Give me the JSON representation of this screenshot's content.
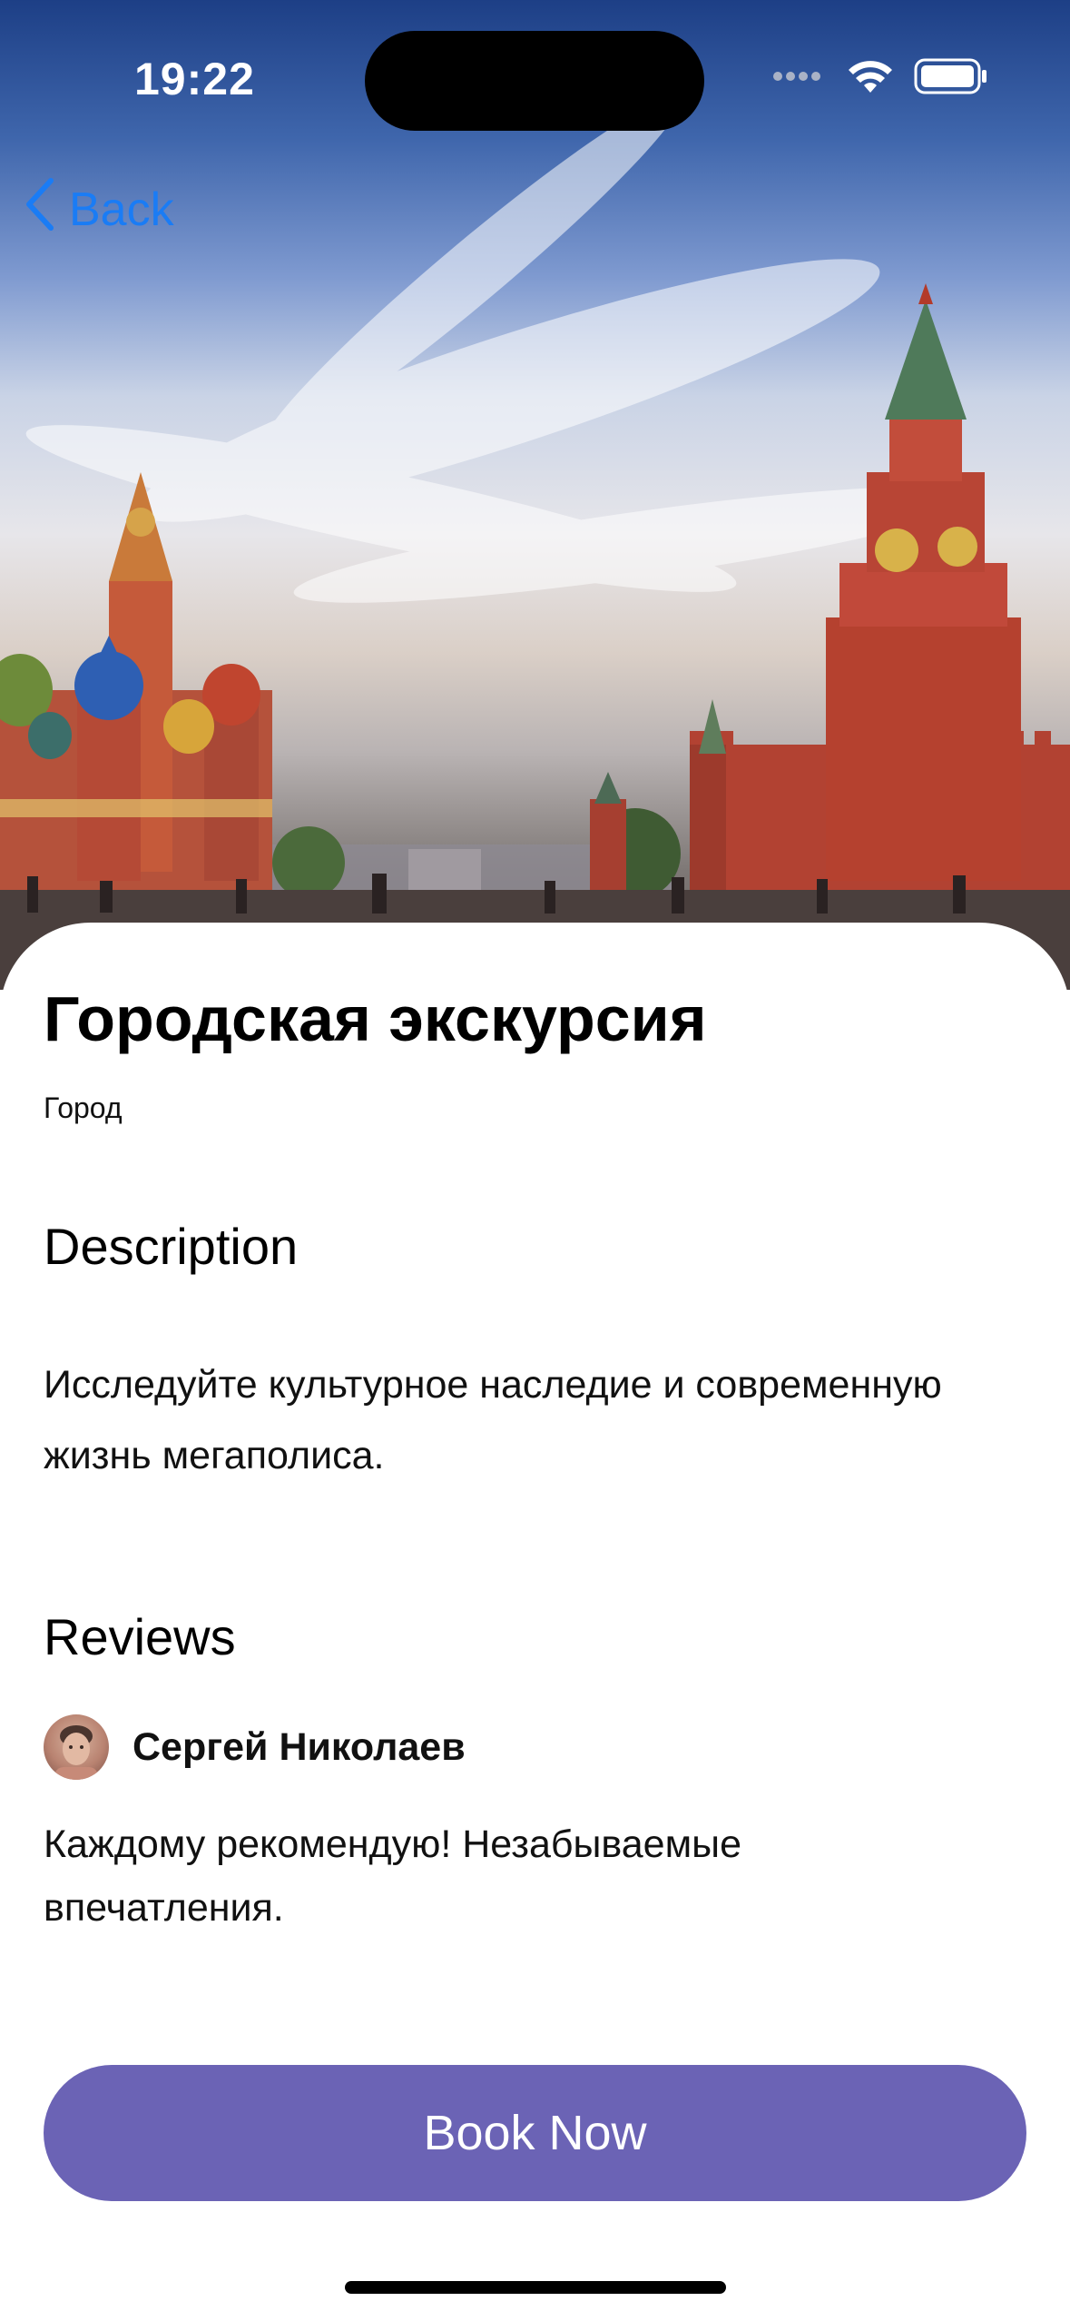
{
  "status_bar": {
    "time": "19:22"
  },
  "nav": {
    "back_label": "Back"
  },
  "tour": {
    "title": "Городская экскурсия",
    "category": "Город"
  },
  "description": {
    "heading": "Description",
    "text": "Исследуйте культурное наследие и современную жизнь мегаполиса."
  },
  "reviews": {
    "heading": "Reviews",
    "items": [
      {
        "author": "Сергей Николаев",
        "text": "Каждому рекомендую! Незабываемые впечатления."
      }
    ]
  },
  "actions": {
    "book_label": "Book Now"
  },
  "colors": {
    "accent": "#6b63b5",
    "link": "#1a7cf5"
  }
}
